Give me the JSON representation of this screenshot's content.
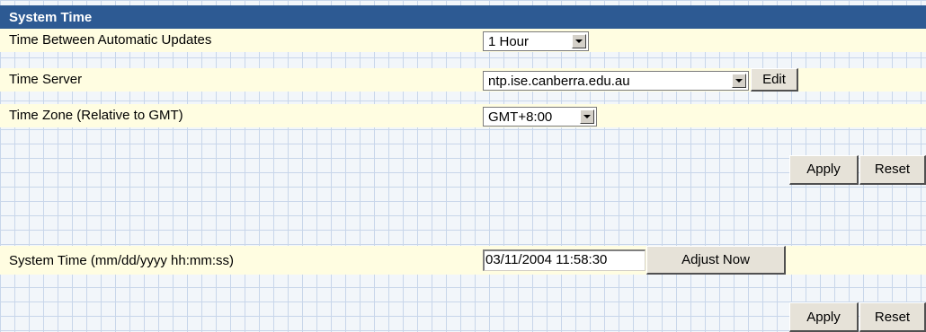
{
  "section": {
    "title": "System Time"
  },
  "settings": {
    "update_interval": {
      "label": "Time Between Automatic Updates",
      "selected": "1 Hour"
    },
    "time_server": {
      "label": "Time Server",
      "selected": "ntp.ise.canberra.edu.au",
      "edit_label": "Edit"
    },
    "time_zone": {
      "label": "Time Zone (Relative to GMT)",
      "selected": "GMT+8:00"
    },
    "apply_label": "Apply",
    "reset_label": "Reset"
  },
  "system_time": {
    "label": "System Time (mm/dd/yyyy hh:mm:ss)",
    "value": "03/11/2004 11:58:30",
    "adjust_label": "Adjust Now",
    "apply_label": "Apply",
    "reset_label": "Reset"
  },
  "colors": {
    "header_bg": "#2d5a93",
    "row_bg": "#fffde1",
    "grid_line": "#c8d6ea"
  }
}
